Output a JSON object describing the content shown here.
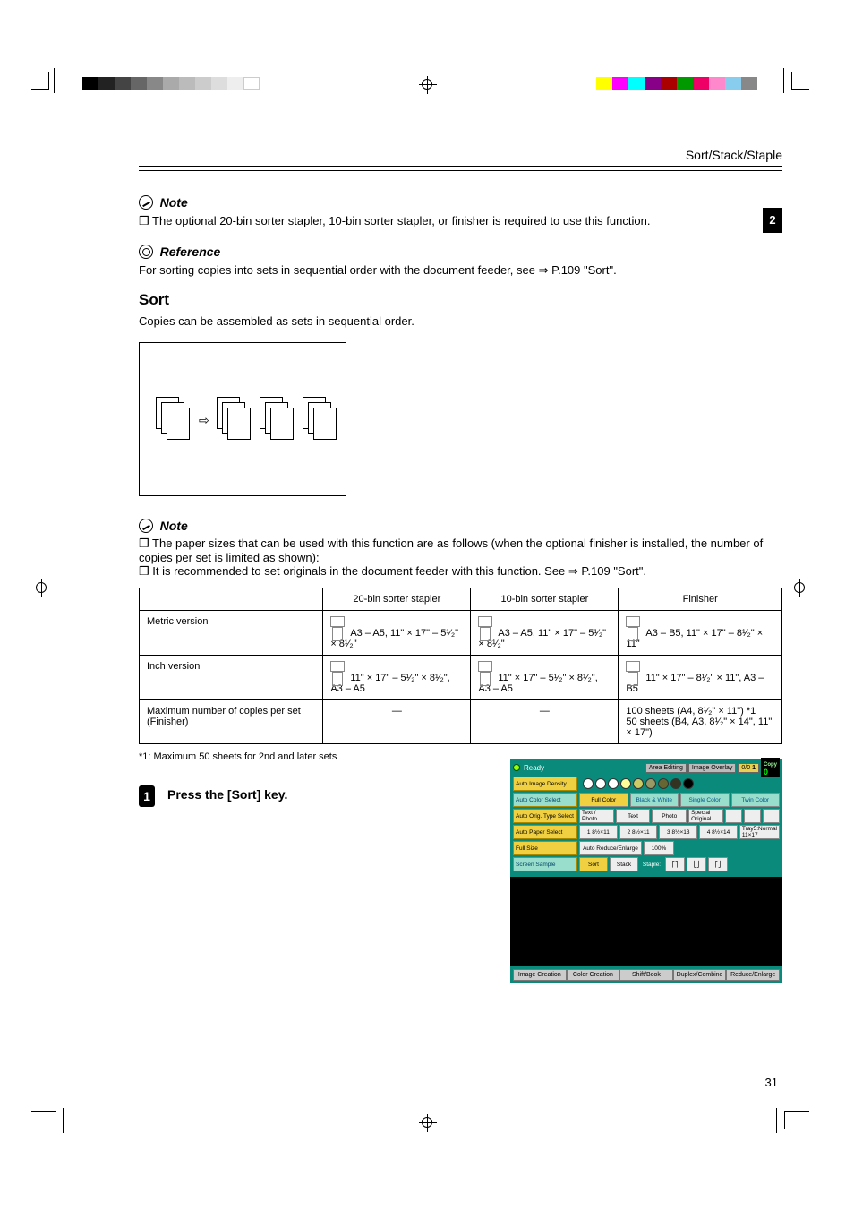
{
  "header": {
    "right": "Sort/Stack/Staple",
    "tab": "2"
  },
  "note1": {
    "label": "Note",
    "text": "❒ The optional 20-bin sorter stapler, 10-bin sorter stapler, or finisher is required to use this function."
  },
  "reference": {
    "label": "Reference",
    "text": "For sorting copies into sets in sequential order with the document feeder, see ⇒ P.109 \"Sort\"."
  },
  "sort": {
    "title": "Sort",
    "desc": "Copies can be assembled as sets in sequential order."
  },
  "note2": {
    "label": "Note",
    "text": "❒ The paper sizes that can be used with this function are as follows (when the optional finisher is installed, the number of copies per set is limited as shown):\n❒ It is recommended to set originals in the document feeder with this function. See ⇒ P.109 \"Sort\"."
  },
  "table": {
    "head": [
      "",
      "20-bin sorter stapler",
      "10-bin sorter stapler",
      "Finisher"
    ],
    "rows": [
      {
        "label": "Metric version",
        "c1": "A3 – A5, 11\" × 17\" – 5¹⁄₂\" × 8¹⁄₂\"",
        "c2": "A3 – A5, 11\" × 17\" – 5¹⁄₂\" × 8¹⁄₂\"",
        "c3": "A3 – B5, 11\" × 17\" – 8¹⁄₂\" × 11\""
      },
      {
        "label": "Inch version",
        "c1": "11\" × 17\" – 5¹⁄₂\" × 8¹⁄₂\", A3 – A5",
        "c2": "11\" × 17\" – 5¹⁄₂\" × 8¹⁄₂\", A3 – A5",
        "c3": "11\" × 17\" – 8¹⁄₂\" × 11\", A3 – B5"
      },
      {
        "label": "Maximum number of copies per set (Finisher)",
        "c1": "—",
        "c2": "—",
        "c3": "100 sheets (A4, 8¹⁄₂\" × 11\") *1\n50 sheets (B4, A3, 8¹⁄₂\" × 14\", 11\" × 17\")"
      }
    ],
    "footnote": "*1: Maximum 50 sheets for 2nd and later sets"
  },
  "step1": {
    "num": "1",
    "text": "Press the [Sort] key."
  },
  "panel": {
    "ready": "Ready",
    "area_editing": "Area Editing",
    "image_overlay": "Image Overlay",
    "pct": "0/0",
    "copy": "Copy",
    "one": "1",
    "zero": "0",
    "auto_density": "Auto Image Density",
    "auto_color": "Auto Color Select",
    "full_color": "Full Color",
    "black_white": "Black & White",
    "single_color": "Single Color",
    "twin_color": "Twin Color",
    "auto_orig": "Auto Orig. Type Select",
    "text_photo": "Text / Photo",
    "text": "Text",
    "photo": "Photo",
    "special": "Special Original",
    "auto_paper": "Auto Paper Select",
    "tray1": "1  8½×11",
    "tray2": "2  8½×11",
    "tray3": "3  8½×13",
    "tray4": "4  8½×14",
    "tray5": "Tray5:Normal  11×17",
    "full_size": "Full Size",
    "auto_reduce": "Auto Reduce/Enlarge",
    "hundred": "100%",
    "sample": "Screen Sample",
    "sort": "Sort",
    "stack": "Stack",
    "staple": "Staple:",
    "bot": [
      "Image Creation",
      "Color Creation",
      "Shift/Book",
      "Duplex/Combine",
      "Reduce/Enlarge"
    ]
  },
  "page_num": "31"
}
